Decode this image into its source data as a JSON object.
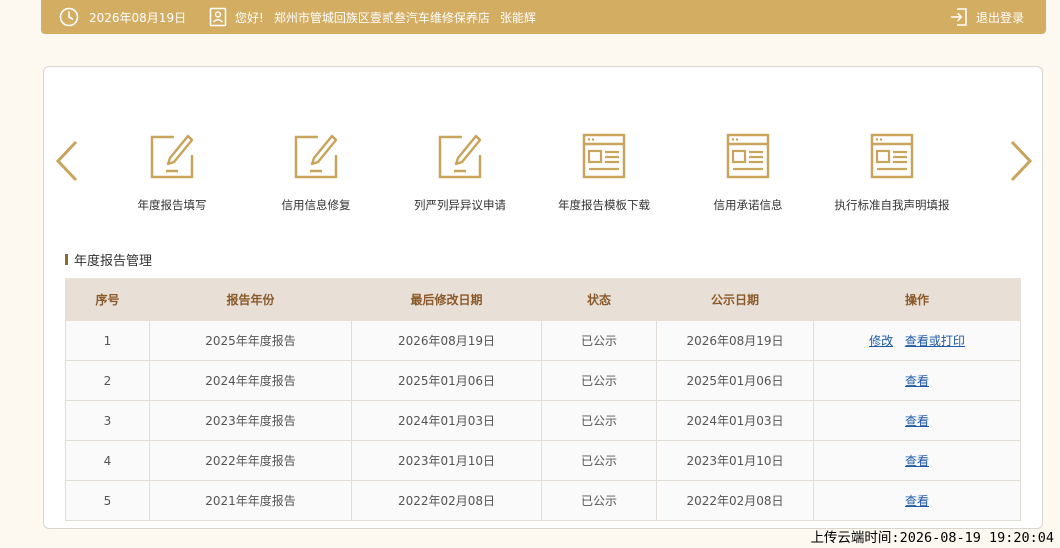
{
  "header": {
    "date": "2026年08月19日",
    "greeting": "您好!",
    "shop_name": "郑州市管城回族区壹贰叁汽车维修保养店",
    "user_name": "张能辉",
    "logout_label": "退出登录"
  },
  "features": [
    {
      "label": "年度报告填写",
      "icon": "edit-icon"
    },
    {
      "label": "信用信息修复",
      "icon": "edit-icon"
    },
    {
      "label": "列严列异异议申请",
      "icon": "edit-icon"
    },
    {
      "label": "年度报告模板下载",
      "icon": "document-icon"
    },
    {
      "label": "信用承诺信息",
      "icon": "document-icon"
    },
    {
      "label": "执行标准自我声明填报",
      "icon": "document-icon"
    }
  ],
  "section_title": "年度报告管理",
  "table": {
    "headers": [
      "序号",
      "报告年份",
      "最后修改日期",
      "状态",
      "公示日期",
      "操作"
    ],
    "rows": [
      {
        "no": "1",
        "year": "2025年年度报告",
        "modified": "2026年08月19日",
        "status": "已公示",
        "published": "2026年08月19日",
        "actions": [
          "修改",
          "查看或打印"
        ]
      },
      {
        "no": "2",
        "year": "2024年年度报告",
        "modified": "2025年01月06日",
        "status": "已公示",
        "published": "2025年01月06日",
        "actions": [
          "查看"
        ]
      },
      {
        "no": "3",
        "year": "2023年年度报告",
        "modified": "2024年01月03日",
        "status": "已公示",
        "published": "2024年01月03日",
        "actions": [
          "查看"
        ]
      },
      {
        "no": "4",
        "year": "2022年年度报告",
        "modified": "2023年01月10日",
        "status": "已公示",
        "published": "2023年01月10日",
        "actions": [
          "查看"
        ]
      },
      {
        "no": "5",
        "year": "2021年年度报告",
        "modified": "2022年02月08日",
        "status": "已公示",
        "published": "2022年02月08日",
        "actions": [
          "查看"
        ]
      }
    ]
  },
  "upload_time": "上传云端时间:2026-08-19 19:20:04",
  "colors": {
    "header_bg": "#d3ad62",
    "accent": "#c9a45c",
    "table_header_bg": "#e8e0d6",
    "table_header_text": "#8b5a2b",
    "link": "#1f5aa8"
  }
}
